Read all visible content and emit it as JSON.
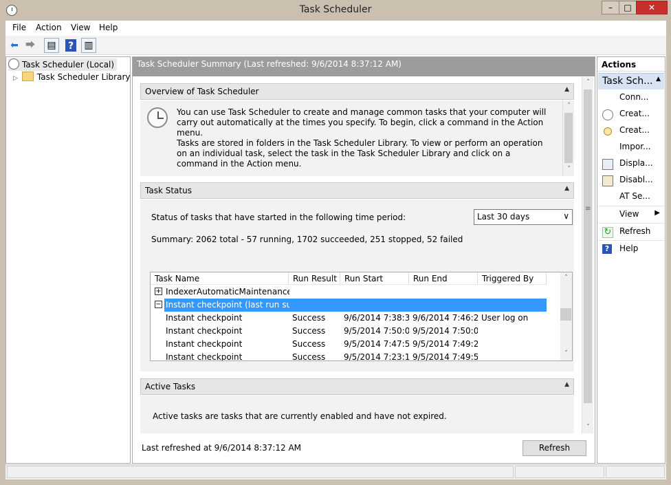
{
  "window": {
    "title": "Task Scheduler"
  },
  "menu": [
    "File",
    "Action",
    "View",
    "Help"
  ],
  "tree": {
    "root": "Task Scheduler (Local)",
    "child": "Task Scheduler Library"
  },
  "center": {
    "header": "Task Scheduler Summary (Last refreshed: 9/6/2014 8:37:12 AM)",
    "overview": {
      "title": "Overview of Task Scheduler",
      "para1": "You can use Task Scheduler to create and manage common tasks that your computer will carry out automatically at the times you specify. To begin, click a command in the Action menu.",
      "para2": "Tasks are stored in folders in the Task Scheduler Library. To view or perform an operation on an individual task, select the task in the Task Scheduler Library and click on a command in the Action menu."
    },
    "task_status": {
      "title": "Task Status",
      "period_label": "Status of tasks that have started in the following time period:",
      "period_value": "Last 30 days",
      "summary": "Summary: 2062 total - 57 running, 1702 succeeded, 251 stopped, 52 failed",
      "columns": [
        "Task Name",
        "Run Result",
        "Run Start",
        "Run End",
        "Triggered By"
      ],
      "groups": [
        {
          "toggle": "+",
          "name": "IndexerAutomaticMaintenance ...",
          "selected": false
        },
        {
          "toggle": "−",
          "name": "Instant checkpoint (last run suc...",
          "selected": true
        }
      ],
      "rows": [
        {
          "name": "Instant checkpoint",
          "result": "Success",
          "start": "9/6/2014 7:38:3...",
          "end": "9/6/2014 7:46:2...",
          "trigger": "User log on"
        },
        {
          "name": "Instant checkpoint",
          "result": "Success",
          "start": "9/5/2014 7:50:0...",
          "end": "9/5/2014 7:50:0...",
          "trigger": ""
        },
        {
          "name": "Instant checkpoint",
          "result": "Success",
          "start": "9/5/2014 7:47:5...",
          "end": "9/5/2014 7:49:2...",
          "trigger": ""
        },
        {
          "name": "Instant checkpoint",
          "result": "Success",
          "start": "9/5/2014 7:23:1...",
          "end": "9/5/2014 7:49:5...",
          "trigger": ""
        }
      ]
    },
    "active_tasks": {
      "title": "Active Tasks",
      "text": "Active tasks are tasks that are currently enabled and have not expired."
    },
    "footer": {
      "last_refreshed": "Last refreshed at 9/6/2014 8:37:12 AM",
      "refresh_button": "Refresh"
    }
  },
  "actions": {
    "title": "Actions",
    "group": "Task Sch...",
    "items": [
      {
        "label": "Conn...",
        "icon": "none"
      },
      {
        "label": "Creat...",
        "icon": "clock-icon"
      },
      {
        "label": "Creat...",
        "icon": "clock-icon"
      },
      {
        "label": "Impor...",
        "icon": "none"
      },
      {
        "label": "Displa...",
        "icon": "list-icon"
      },
      {
        "label": "Disabl...",
        "icon": "list-icon"
      },
      {
        "label": "AT Se...",
        "icon": "none"
      },
      {
        "label": "View",
        "icon": "none"
      },
      {
        "label": "Refresh",
        "icon": "refresh-icon"
      },
      {
        "label": "Help",
        "icon": "help-icon"
      }
    ]
  },
  "colors": {
    "selection": "#3399ff",
    "header_gray": "#9c9c9c",
    "section_bg": "#f2f2f2"
  }
}
